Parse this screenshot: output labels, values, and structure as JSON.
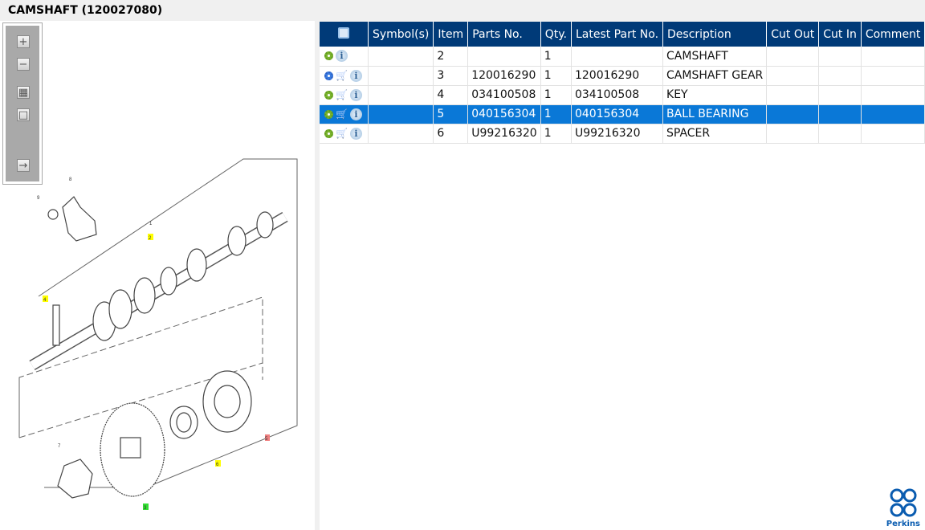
{
  "title": "CAMSHAFT (120027080)",
  "toolbar": {
    "buttons": [
      "zoom-in",
      "zoom-out",
      "fit-all",
      "actual-size",
      "show-list"
    ]
  },
  "diagram": {
    "callouts": [
      {
        "label": "8",
        "color": "none"
      },
      {
        "label": "9",
        "color": "none"
      },
      {
        "label": "1",
        "color": "none"
      },
      {
        "label": "2",
        "color": "#ffff00"
      },
      {
        "label": "4",
        "color": "#ffff00"
      },
      {
        "label": "7",
        "color": "none"
      },
      {
        "label": "3",
        "color": "#33dd33"
      },
      {
        "label": "6",
        "color": "#ffff00"
      },
      {
        "label": "5",
        "color": "#f08080"
      }
    ]
  },
  "grid": {
    "columns": [
      "",
      "Symbol(s)",
      "Item",
      "Parts No.",
      "Qty.",
      "Latest Part No.",
      "Description",
      "Cut Out",
      "Cut In",
      "Comment"
    ],
    "rows": [
      {
        "icons": [
          "gear-green",
          "info"
        ],
        "symbols": "",
        "item": "2",
        "part": "",
        "qty": "1",
        "latest": "",
        "desc": "CAMSHAFT",
        "cut_out": "",
        "cut_in": "",
        "comment": "",
        "selected": false
      },
      {
        "icons": [
          "gears-blue-green",
          "cart",
          "info"
        ],
        "symbols": "",
        "item": "3",
        "part": "120016290",
        "qty": "1",
        "latest": "120016290",
        "desc": "CAMSHAFT GEAR",
        "cut_out": "",
        "cut_in": "",
        "comment": "",
        "selected": false
      },
      {
        "icons": [
          "gear-green",
          "cart",
          "info"
        ],
        "symbols": "",
        "item": "4",
        "part": "034100508",
        "qty": "1",
        "latest": "034100508",
        "desc": "KEY",
        "cut_out": "",
        "cut_in": "",
        "comment": "",
        "selected": false
      },
      {
        "icons": [
          "gear-green",
          "cart",
          "info"
        ],
        "symbols": "",
        "item": "5",
        "part": "040156304",
        "qty": "1",
        "latest": "040156304",
        "desc": "BALL BEARING",
        "cut_out": "",
        "cut_in": "",
        "comment": "",
        "selected": true
      },
      {
        "icons": [
          "gear-green",
          "cart",
          "info"
        ],
        "symbols": "",
        "item": "6",
        "part": "U99216320",
        "qty": "1",
        "latest": "U99216320",
        "desc": "SPACER",
        "cut_out": "",
        "cut_in": "",
        "comment": "",
        "selected": false
      }
    ]
  },
  "logo": {
    "text": "Perkins"
  },
  "colors": {
    "header": "#003a78",
    "selected": "#0a78d7"
  }
}
